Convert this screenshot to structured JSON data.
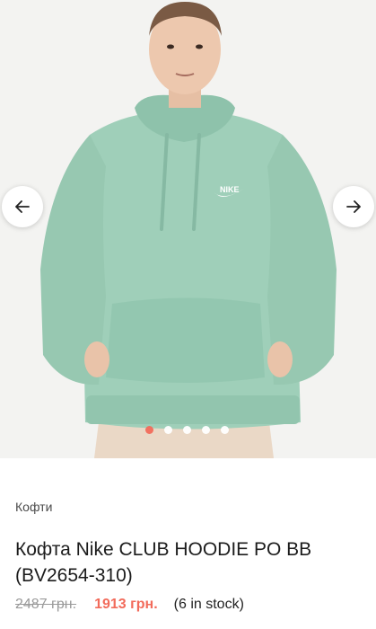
{
  "gallery": {
    "brand_mark": "NIKE",
    "slide_count": 5,
    "active_slide": 1
  },
  "product": {
    "category": "Кофти",
    "title": "Кофта Nike CLUB HOODIE PO BB (BV2654-310)",
    "old_price": "2487 грн.",
    "new_price": "1913 грн.",
    "stock": "(6 in stock)"
  },
  "colors": {
    "hoodie": "#9fcfb9",
    "accent": "#f26b5b",
    "muted_text": "#9a9a9a"
  },
  "icons": {
    "prev": "arrow-left-icon",
    "next": "arrow-right-icon"
  }
}
